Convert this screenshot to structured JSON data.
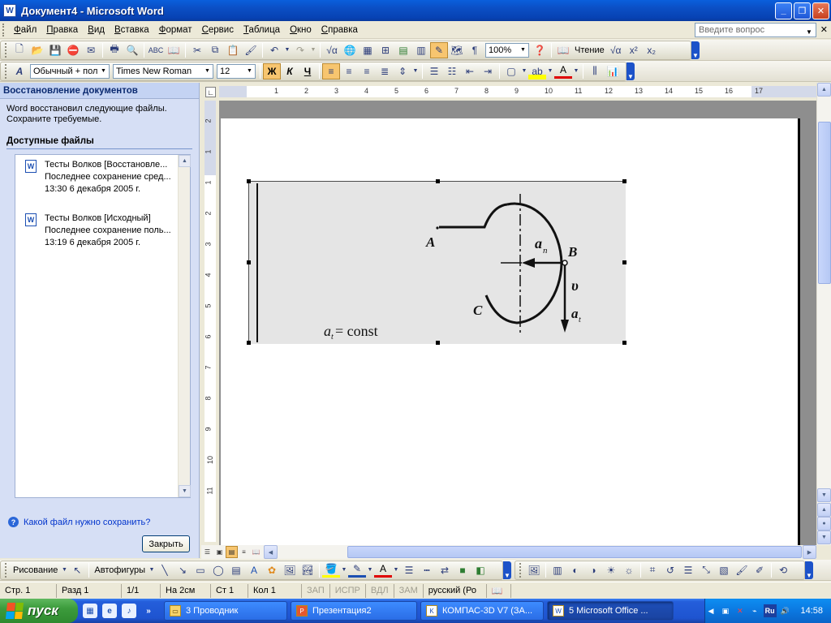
{
  "window": {
    "title": "Документ4 - Microsoft Word",
    "app_icon": "W"
  },
  "menu": {
    "items": [
      "Файл",
      "Правка",
      "Вид",
      "Вставка",
      "Формат",
      "Сервис",
      "Таблица",
      "Окно",
      "Справка"
    ],
    "help_placeholder": "Введите вопрос"
  },
  "toolbar_standard": {
    "zoom": "100%",
    "reading_label": "Чтение"
  },
  "toolbar_format": {
    "style": "Обычный + пол",
    "font": "Times New Roman",
    "size": "12",
    "bold": "Ж",
    "italic": "К",
    "underline": "Ч"
  },
  "taskpane": {
    "title": "Восстановление документов",
    "description_line1": "Word восстановил следующие файлы.",
    "description_line2": "Сохраните требуемые.",
    "available_title": "Доступные файлы",
    "files": [
      {
        "name": "Тесты Волков  [Восстановле...",
        "saved": "Последнее сохранение сред...",
        "time": "13:30 6 декабря 2005 г."
      },
      {
        "name": "Тесты Волков  [Исходный]",
        "saved": "Последнее сохранение поль...",
        "time": "13:19 6 декабря 2005 г."
      }
    ],
    "question_link": "Какой файл нужно сохранить?",
    "close_label": "Закрыть"
  },
  "ruler": {
    "h_numbers": [
      "1",
      "2",
      "3",
      "4",
      "5",
      "6",
      "7",
      "8",
      "9",
      "10",
      "11",
      "12",
      "13",
      "14",
      "15",
      "16",
      "17"
    ],
    "v_numbers": [
      "2",
      "1",
      "1",
      "2",
      "3",
      "4",
      "5",
      "6",
      "7",
      "8",
      "9",
      "10",
      "11"
    ]
  },
  "figure": {
    "label_A": "A",
    "label_B": "B",
    "label_C": "C",
    "label_an": "a",
    "label_an_sub": "n",
    "label_v": "υ",
    "label_at": "a",
    "label_at_sub": "t",
    "formula_a": "a",
    "formula_sub": "t",
    "formula_rest": " = const"
  },
  "drawing_toolbar": {
    "draw_label": "Рисование",
    "autoshapes_label": "Автофигуры"
  },
  "statusbar": {
    "page": "Стр.  1",
    "section": "Разд  1",
    "pages": "1/1",
    "at": "На  2см",
    "line": "Ст  1",
    "col": "Кол  1",
    "rec": "ЗАП",
    "trk": "ИСПР",
    "ext": "ВДЛ",
    "ovr": "ЗАМ",
    "language": "русский (Ро"
  },
  "taskbar": {
    "start_label": "пуск",
    "tasks": [
      {
        "label": "3 Проводник",
        "icon": "folder-icon"
      },
      {
        "label": "Презентация2",
        "icon": "powerpoint-icon"
      },
      {
        "label": "КОМПАС-3D V7 (ЗА...",
        "icon": "kompas-icon"
      },
      {
        "label": "5 Microsoft Office ...",
        "icon": "word-icon"
      }
    ],
    "clock": "14:58",
    "lang": "Ru"
  }
}
